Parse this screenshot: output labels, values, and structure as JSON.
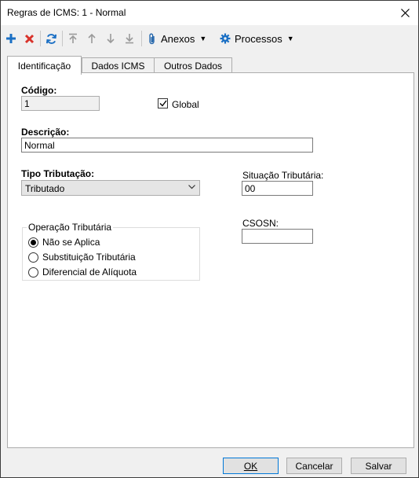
{
  "window": {
    "title": "Regras de ICMS: 1 - Normal"
  },
  "toolbar": {
    "anexos_label": "Anexos",
    "processos_label": "Processos"
  },
  "tabs": [
    {
      "label": "Identificação",
      "active": true
    },
    {
      "label": "Dados ICMS",
      "active": false
    },
    {
      "label": "Outros Dados",
      "active": false
    }
  ],
  "form": {
    "codigo_label": "Código:",
    "codigo_value": "1",
    "global_label": "Global",
    "global_checked": true,
    "descricao_label": "Descrição:",
    "descricao_value": "Normal",
    "tipo_tributacao_label": "Tipo Tributação:",
    "tipo_tributacao_value": "Tributado",
    "situacao_tributaria_label": "Situação Tributária:",
    "situacao_tributaria_value": "00",
    "csosn_label": "CSOSN:",
    "csosn_value": "",
    "operacao_group_label": "Operação Tributária",
    "operacao_options": [
      {
        "label": "Não se Aplica",
        "selected": true
      },
      {
        "label": "Substituição Tributária",
        "selected": false
      },
      {
        "label": "Diferencial de Alíquota",
        "selected": false
      }
    ]
  },
  "buttons": {
    "ok_label": "OK",
    "cancelar_label": "Cancelar",
    "salvar_label": "Salvar"
  },
  "colors": {
    "add_icon": "#1a6fc4",
    "delete_icon": "#d9332b",
    "refresh_icon": "#1a6fc4",
    "disabled_icon": "#9a9a9a",
    "gear_icon": "#1a6fc4"
  }
}
